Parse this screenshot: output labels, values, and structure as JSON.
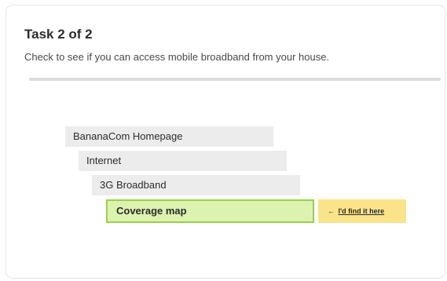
{
  "task": {
    "title": "Task 2 of 2",
    "instruction": "Check to see if you can access mobile broadband from your house.",
    "progress_fraction": 1.0
  },
  "tree": {
    "items": [
      {
        "label": "BananaCom Homepage"
      },
      {
        "label": "Internet"
      },
      {
        "label": "3G Broadband"
      },
      {
        "label": "Coverage map"
      }
    ],
    "selected_index": 3
  },
  "found_tag": {
    "arrow": "←",
    "label": "I'd find it here"
  },
  "colors": {
    "selected_fill": "#dcf3b0",
    "selected_border": "#9ad048",
    "tag_fill": "#fbe38a",
    "item_fill": "#ececec"
  }
}
